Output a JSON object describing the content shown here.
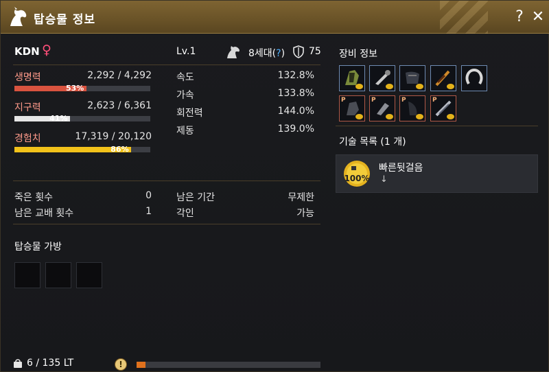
{
  "window": {
    "title": "탑승물 정보",
    "help_label": "?",
    "close_label": "✕"
  },
  "mount": {
    "name": "KDN",
    "gender_symbol": "♀",
    "level": "Lv.1",
    "generation": "8세대(",
    "generation_help": "?",
    "generation_close": ")",
    "armor": "75"
  },
  "bars": [
    {
      "label": "생명력",
      "value": "2,292 / 4,292",
      "pct_label": "53%",
      "fraction": 0.53,
      "color": "#d9533f"
    },
    {
      "label": "지구력",
      "value": "2,623 / 6,361",
      "pct_label": "41%",
      "fraction": 0.41,
      "color": "#e6e6e6"
    },
    {
      "label": "경험치",
      "value": "17,319 / 20,120",
      "pct_label": "86%",
      "fraction": 0.86,
      "color": "#f2c21a"
    }
  ],
  "stats": [
    {
      "label": "속도",
      "value": "132.8%"
    },
    {
      "label": "가속",
      "value": "133.8%"
    },
    {
      "label": "회전력",
      "value": "144.0%"
    },
    {
      "label": "제동",
      "value": "139.0%"
    }
  ],
  "info": {
    "death_label": "죽은 횟수",
    "death_value": "0",
    "remaining_period_label": "남은 기간",
    "remaining_period_value": "무제한",
    "breed_label": "남은 교배 횟수",
    "breed_value": "1",
    "imprint_label": "각인",
    "imprint_value": "가능"
  },
  "bag": {
    "title": "탑승물 가방",
    "slots": 3
  },
  "equipment": {
    "title": "장비 정보"
  },
  "skills": {
    "title": "기술 목록 (1 개)",
    "items": [
      {
        "name": "빠른뒷걸음",
        "percent": "100%",
        "arrow": "↓"
      }
    ]
  },
  "footer": {
    "weight": "6 / 135 LT",
    "warning_icon": "!",
    "progress_fraction": 0.05
  }
}
